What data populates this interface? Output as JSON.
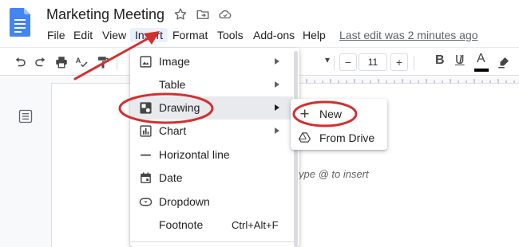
{
  "document": {
    "title": "Marketing Meeting",
    "last_edit": "Last edit was 2 minutes ago",
    "placeholder": "ype @ to insert"
  },
  "menubar": {
    "items": [
      "File",
      "Edit",
      "View",
      "Insert",
      "Format",
      "Tools",
      "Add-ons",
      "Help"
    ],
    "active": "Insert"
  },
  "toolbar": {
    "font_size": "11",
    "minus": "−",
    "plus": "+",
    "bold": "B",
    "italic": "I",
    "underline": "U",
    "text_color": "A",
    "text_color_bar": "#000000"
  },
  "insert_menu": {
    "items": [
      {
        "label": "Image",
        "icon": "image-icon",
        "has_submenu": true
      },
      {
        "label": "Table",
        "icon": "",
        "has_submenu": true
      },
      {
        "label": "Drawing",
        "icon": "drawing-icon",
        "has_submenu": true,
        "highlighted": true
      },
      {
        "label": "Chart",
        "icon": "chart-icon",
        "has_submenu": true
      },
      {
        "label": "Horizontal line",
        "icon": "horizontal-line-icon",
        "has_submenu": false
      },
      {
        "label": "Date",
        "icon": "calendar-icon",
        "has_submenu": false
      },
      {
        "label": "Dropdown",
        "icon": "dropdown-chip-icon",
        "has_submenu": false
      },
      {
        "label": "Footnote",
        "icon": "",
        "has_submenu": false,
        "shortcut": "Ctrl+Alt+F"
      }
    ]
  },
  "drawing_submenu": {
    "items": [
      {
        "label": "New",
        "icon": "plus-icon"
      },
      {
        "label": "From Drive",
        "icon": "drive-icon"
      }
    ]
  },
  "annotation_color": "#d32f2f"
}
